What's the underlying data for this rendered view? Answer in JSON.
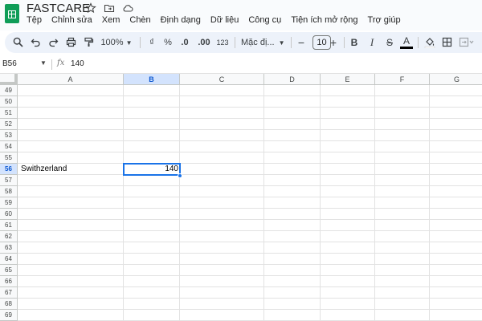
{
  "app": {
    "title": "FASTCARE",
    "brand_color": "#0f9d58",
    "title_icons": [
      "star-icon",
      "move-to-folder-icon",
      "cloud-status-icon"
    ]
  },
  "menu": [
    "Tệp",
    "Chỉnh sửa",
    "Xem",
    "Chèn",
    "Định dạng",
    "Dữ liệu",
    "Công cụ",
    "Tiện ích mở rộng",
    "Trợ giúp"
  ],
  "toolbar": {
    "zoom": "100%",
    "currency": "₫",
    "percent": "%",
    "decrease_decimal": ".0",
    "increase_decimal": ".00",
    "number_format": "123",
    "font_name": "Mặc đị...",
    "minus": "−",
    "font_size": "10",
    "plus": "+",
    "bold": "B",
    "italic": "I",
    "strikethrough": "S",
    "text_color": "A",
    "icons": [
      "search-icon",
      "undo-icon",
      "redo-icon",
      "print-icon",
      "paint-format-icon",
      "fill-color-icon",
      "borders-icon",
      "merge-cells-icon"
    ]
  },
  "formula_bar": {
    "name_box": "B56",
    "fx_label": "fx",
    "value": "140"
  },
  "grid": {
    "columns": [
      "A",
      "B",
      "C",
      "D",
      "E",
      "F",
      "G"
    ],
    "active_column": "B",
    "rows": [
      "49",
      "50",
      "51",
      "52",
      "53",
      "54",
      "55",
      "56",
      "57",
      "58",
      "59",
      "60",
      "61",
      "62",
      "63",
      "64",
      "65",
      "66",
      "67",
      "68",
      "69"
    ],
    "active_row": "56",
    "cells": {
      "A56": "Swithzerland",
      "B56": "140"
    },
    "selection_color": "#1a73e8"
  }
}
